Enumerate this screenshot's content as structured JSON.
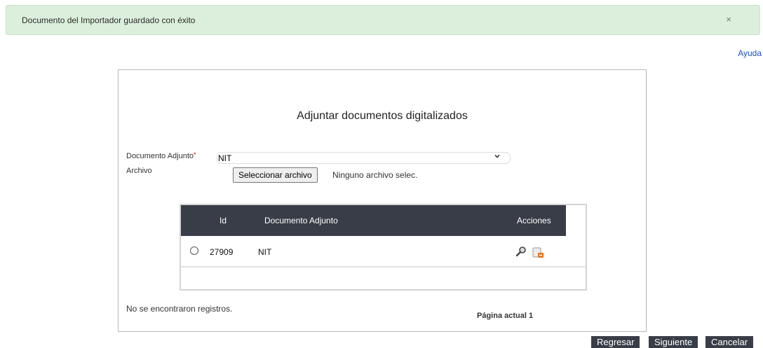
{
  "alert": {
    "message": "Documento del Importador guardado con éxito",
    "close_glyph": "×"
  },
  "help_link": "Ayuda",
  "form": {
    "title": "Adjuntar documentos digitalizados",
    "document_label": "Documento Adjunto",
    "required_mark": "*",
    "document_selected": "NIT",
    "file_label": "Archivo",
    "file_button": "Seleccionar archivo",
    "file_status": "Ninguno archivo selec."
  },
  "grid": {
    "columns": [
      "Id",
      "Documento Adjunto",
      "Acciones"
    ],
    "rows": [
      {
        "id": "27909",
        "document": "NIT",
        "actions": [
          "view-icon",
          "delete-document-icon"
        ]
      }
    ]
  },
  "pager": {
    "empty_message": "No se encontraron registros.",
    "current_page": "Página actual 1"
  },
  "footer_buttons": {
    "back": "Regresar",
    "next": "Siguiente",
    "cancel": "Cancelar"
  },
  "colors": {
    "alert_bg": "#dcefdc",
    "header_dark": "#383d47",
    "link": "#1a4fc4",
    "required": "#cc0000"
  }
}
